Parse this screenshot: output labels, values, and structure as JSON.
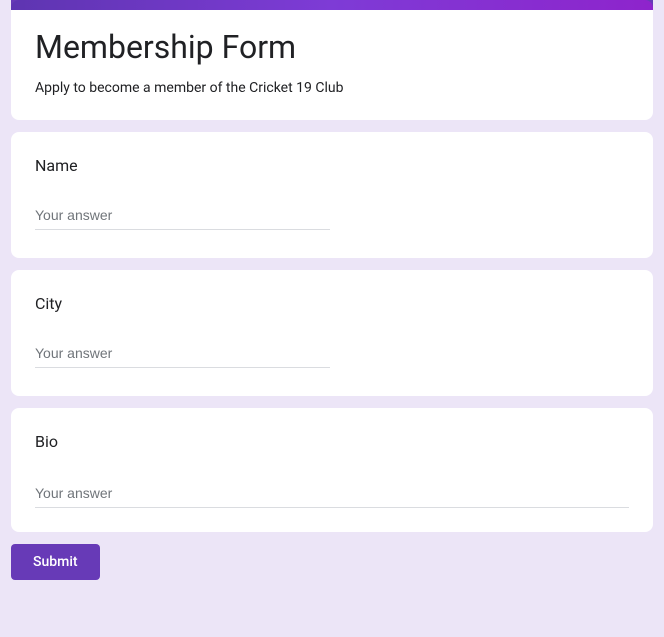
{
  "header": {
    "title": "Membership Form",
    "description": "Apply to become a member of the Cricket 19 Club"
  },
  "questions": [
    {
      "label": "Name",
      "placeholder": "Your answer"
    },
    {
      "label": "City",
      "placeholder": "Your answer"
    },
    {
      "label": "Bio",
      "placeholder": "Your answer"
    }
  ],
  "submit": {
    "label": "Submit"
  }
}
